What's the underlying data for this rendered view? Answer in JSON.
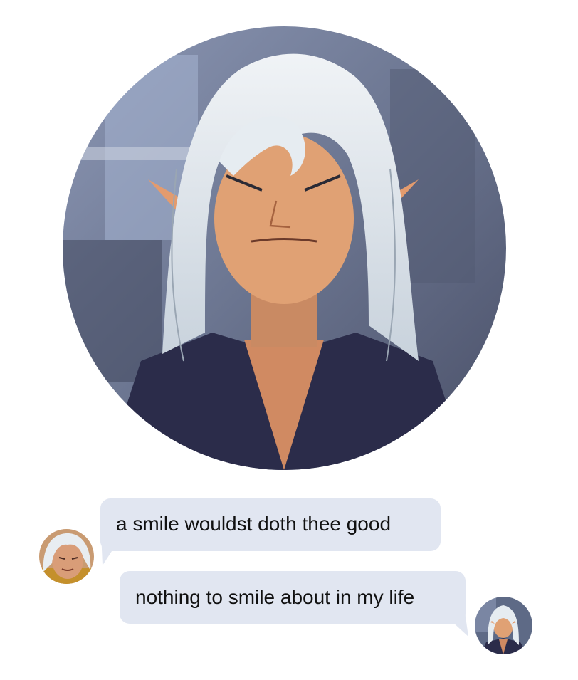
{
  "conversation": {
    "messages": [
      {
        "sender": "left",
        "text": "a smile wouldst doth thee good"
      },
      {
        "sender": "right",
        "text": "nothing to smile about in my life"
      }
    ]
  },
  "colors": {
    "bubble_background": "#e1e6f1",
    "message_text": "#111111",
    "page_background": "#ffffff",
    "hair": "#dfe6ec",
    "skin": "#e0a174",
    "shirt": "#2b2c4a",
    "background_scene": "#6a7590"
  },
  "icons": {
    "portrait": "elf-portrait-image",
    "left_avatar": "avatar-image",
    "right_avatar": "avatar-image"
  }
}
